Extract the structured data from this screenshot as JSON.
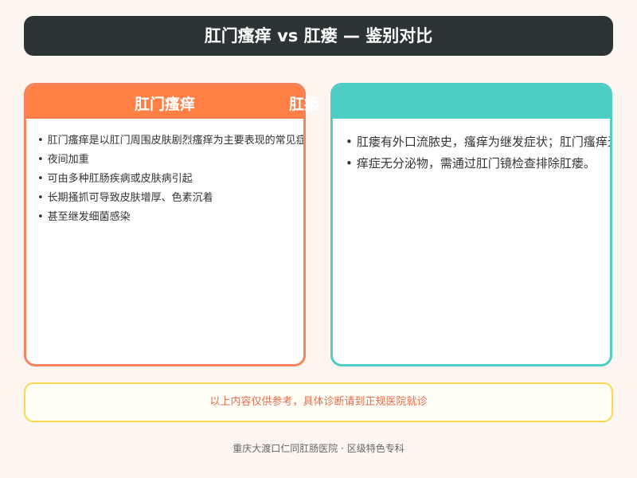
{
  "header": {
    "title": "肛门瘙痒 vs 肛瘘 — 鉴别对比"
  },
  "left_card": {
    "title": "肛门瘙痒",
    "items": [
      "肛门瘙痒是以肛门周围皮肤剧烈瘙痒为主要表现的常见症状",
      "夜间加重",
      "可由多种肛肠疾病或皮肤病引起",
      "长期搔抓可导致皮肤增厚、色素沉着",
      "甚至继发细菌感染"
    ]
  },
  "right_card": {
    "title": "肛瘘",
    "items": [
      "肛瘘有外口流脓史，瘙痒为继发症状；肛门瘙痒无外口",
      "痒症无分泌物，需通过肛门镜检查排除肛瘘。"
    ]
  },
  "notice": {
    "text": "以上内容仅供参考，具体诊断请到正规医院就诊"
  },
  "footer": {
    "text": "重庆大渡口仁同肛肠医院 · 区级特色专科"
  },
  "colors": {
    "header_bg": "#2d3436",
    "left_accent": "#ff7f45",
    "right_accent": "#4ecdc4",
    "notice_border": "#f7d84c",
    "notice_text": "#e36e4d",
    "page_bg": "#fdf6f0"
  }
}
